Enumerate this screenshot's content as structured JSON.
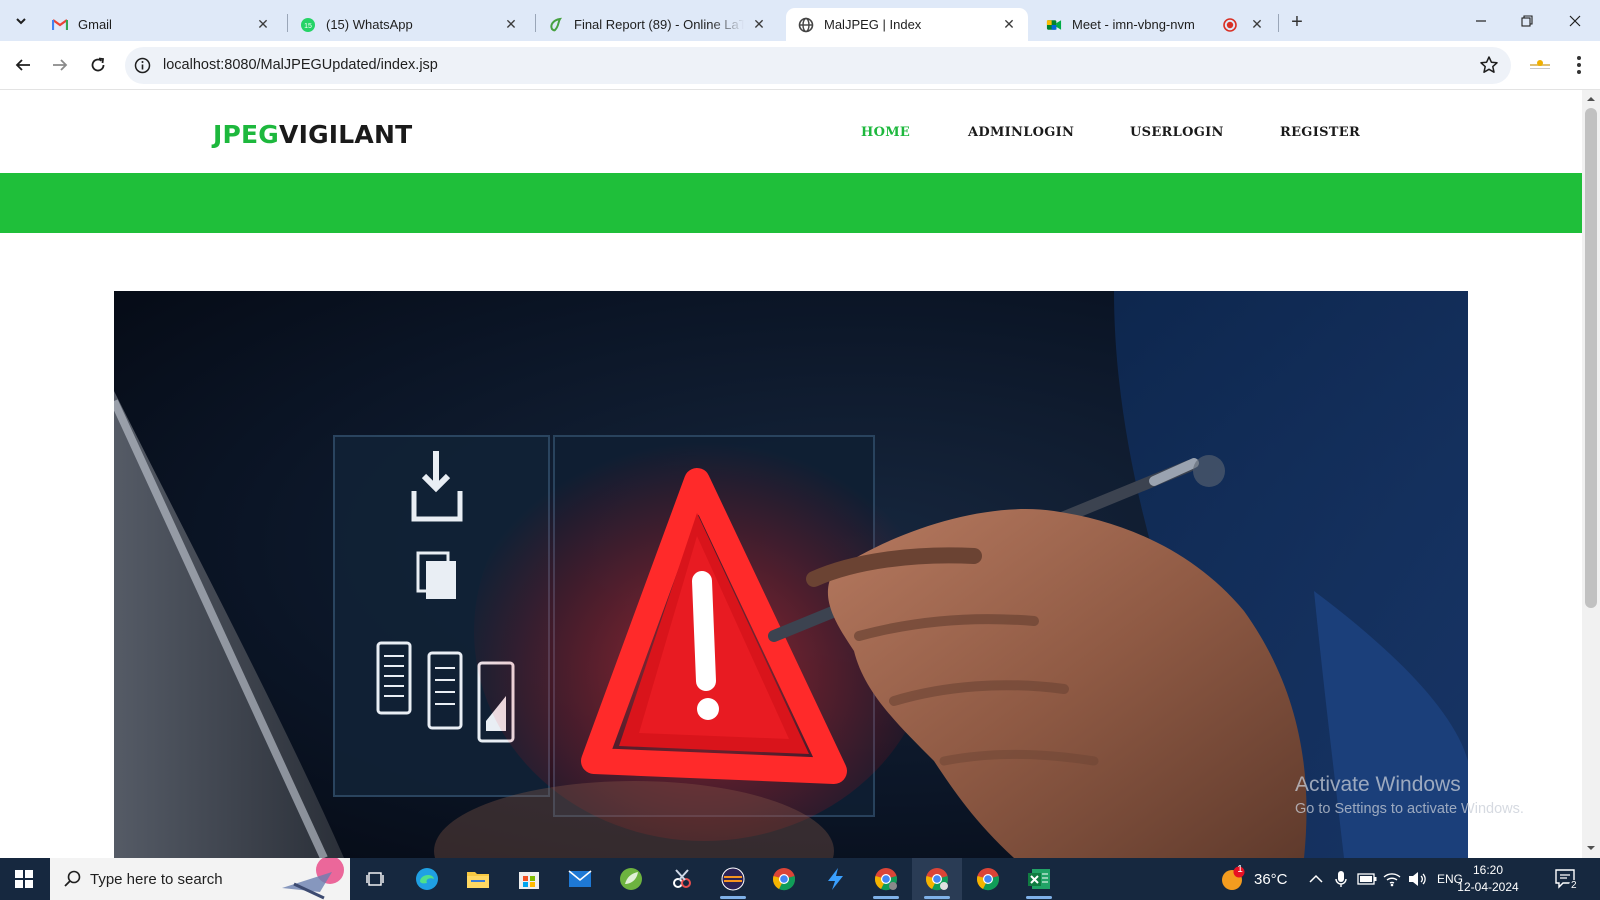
{
  "browser": {
    "tabs": [
      {
        "title": "Gmail",
        "icon": "gmail-icon",
        "active": false
      },
      {
        "title": "(15) WhatsApp",
        "icon": "whatsapp-icon",
        "active": false
      },
      {
        "title": "Final Report (89) - Online LaTeX",
        "icon": "overleaf-icon",
        "active": false
      },
      {
        "title": "MalJPEG | Index",
        "icon": "globe-icon",
        "active": true
      },
      {
        "title": "Meet - imn-vbng-nvm",
        "icon": "google-meet-icon",
        "active": false
      }
    ],
    "recording_indicator": "recording-icon",
    "new_tab_label": "+",
    "window_controls": {
      "minimize": "minimize-icon",
      "restore": "restore-icon",
      "close": "close-icon"
    },
    "address_bar": {
      "url": "localhost:8080/MalJPEGUpdated/index.jsp"
    }
  },
  "site": {
    "logo": {
      "part1": "JPEG",
      "part2": "VIGILANT"
    },
    "nav": [
      {
        "label": "HOME",
        "active": true
      },
      {
        "label": "ADMINLOGIN",
        "active": false
      },
      {
        "label": "USERLOGIN",
        "active": false
      },
      {
        "label": "REGISTER",
        "active": false
      }
    ],
    "accent_color": "#1fbf3a",
    "hero_image": "malware warning triangle over digital file icons"
  },
  "watermark": {
    "line1": "Activate Windows",
    "line2": "Go to Settings to activate Windows."
  },
  "taskbar": {
    "search_placeholder": "Type here to search",
    "weather": {
      "temp": "36°C",
      "badge": "1"
    },
    "language": "ENG",
    "time": "16:20",
    "date": "12-04-2024",
    "notifications": "2"
  }
}
